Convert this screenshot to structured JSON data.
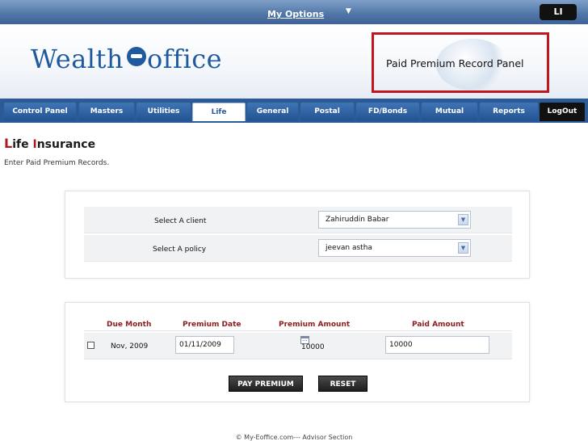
{
  "topbar": {
    "my_options": "My Options",
    "badge": "LI"
  },
  "header": {
    "logo_left": "Wealth",
    "logo_right": "office",
    "panel_label": "Paid Premium Record Panel"
  },
  "nav": {
    "tabs": [
      {
        "label": "Control Panel"
      },
      {
        "label": "Masters"
      },
      {
        "label": "Utilities"
      },
      {
        "label": "Life"
      },
      {
        "label": "General"
      },
      {
        "label": "Postal"
      },
      {
        "label": "FD/Bonds"
      },
      {
        "label": "Mutual"
      },
      {
        "label": "Reports"
      },
      {
        "label": "LogOut"
      }
    ]
  },
  "page": {
    "title_cap": "L",
    "title_rest": "ife ",
    "title_cap2": "I",
    "title_rest2": "nsurance",
    "subtitle": "Enter Paid Premium Records."
  },
  "client_form": {
    "client_label": "Select A client",
    "client_value": "Zahiruddin Babar",
    "policy_label": "Select A policy",
    "policy_value": "jeevan astha"
  },
  "premium_table": {
    "headers": {
      "due_month": "Due Month",
      "premium_date": "Premium Date",
      "premium_amount": "Premium Amount",
      "paid_amount": "Paid Amount"
    },
    "row": {
      "due_month": "Nov, 2009",
      "premium_date": "01/11/2009",
      "premium_amount": "10000",
      "paid_amount": "10000"
    }
  },
  "buttons": {
    "pay_premium": "PAY PREMIUM",
    "reset": "RESET"
  },
  "footer": {
    "text": "© My-Eoffice.com--- Advisor Section"
  },
  "colors": {
    "nav_blue": "#2c5a97",
    "header_red": "#8b1c1f",
    "callout_red": "#c0161d"
  }
}
